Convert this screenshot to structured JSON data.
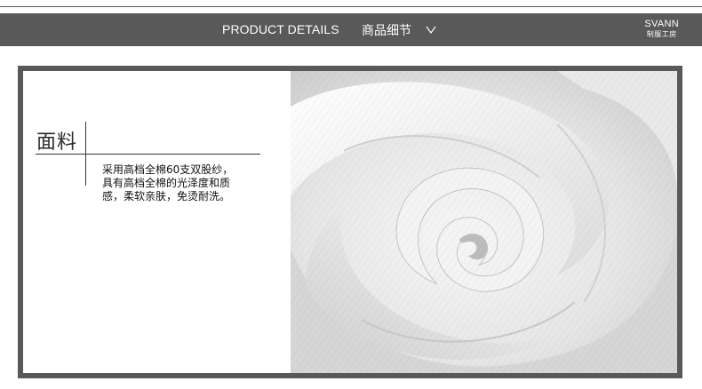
{
  "header": {
    "title_en": "PRODUCT DETAILS",
    "title_cn": "商品细节",
    "expand_icon": "chevron-down-icon"
  },
  "brand": {
    "name": "SVANN",
    "subtitle": "制服工房"
  },
  "detail": {
    "section_title": "面料",
    "description_lines": [
      "采用高档全棉60支双股纱，",
      "具有高档全棉的光泽度和质",
      "感，柔软亲肤，免烫耐洗。"
    ]
  },
  "colors": {
    "bar": "#595959",
    "background": "#ffffff",
    "text": "#111111"
  }
}
